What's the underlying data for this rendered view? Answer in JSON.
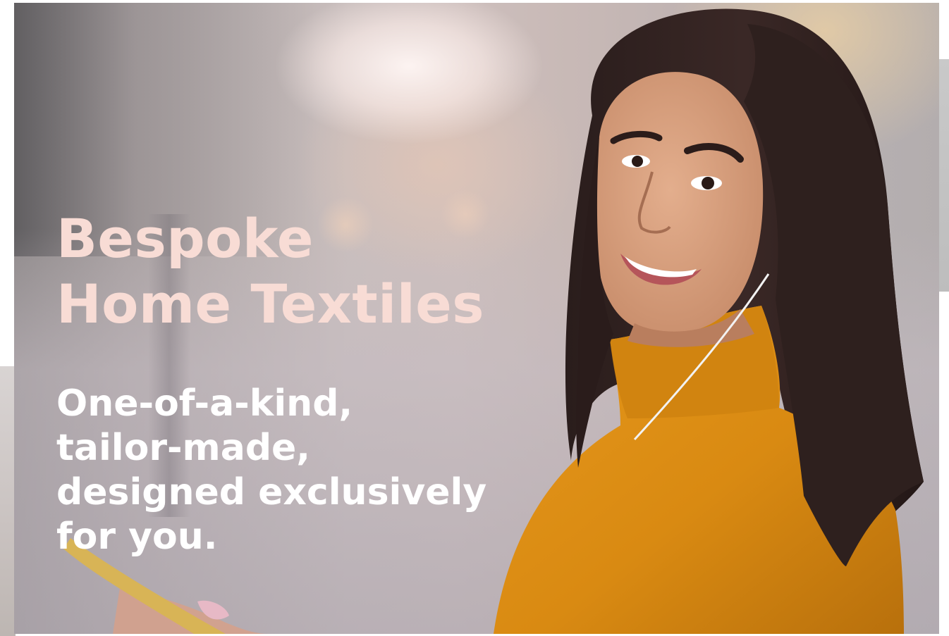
{
  "hero": {
    "headline_line1": "Bespoke",
    "headline_line2": "Home Textiles",
    "subline_line1": "One-of-a-kind,",
    "subline_line2": "tailor-made,",
    "subline_line3": "designed exclusively",
    "subline_line4": "for you."
  },
  "colors": {
    "headline": "#f8dcd5",
    "subline": "#ffffff",
    "sweater": "#d98a12"
  },
  "image": {
    "subject": "smiling-woman-with-earphones-photo"
  }
}
